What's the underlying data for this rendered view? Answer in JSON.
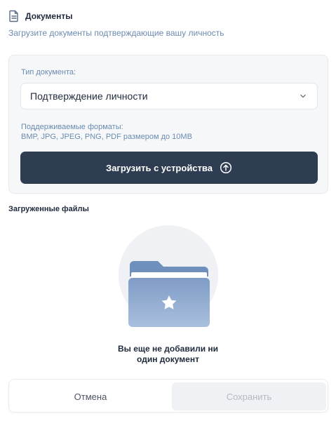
{
  "header": {
    "title": "Документы",
    "subtitle": "Загрузите документы подтверждающие вашу личность"
  },
  "form": {
    "doc_type_label": "Тип документа:",
    "doc_type_value": "Подтверждение личности",
    "formats_line1": "Поддерживаемые форматы:",
    "formats_line2": "BMP, JPG, JPEG, PNG, PDF размером до 10MB",
    "upload_label": "Загрузить с устройства"
  },
  "uploaded": {
    "title": "Загруженные файлы",
    "empty_line1": "Вы еще не добавили ни",
    "empty_line2": "один документ"
  },
  "footer": {
    "cancel_label": "Отмена",
    "save_label": "Сохранить"
  },
  "icons": {
    "document": "document-icon",
    "chevron": "chevron-down-icon",
    "upload": "upload-arrow-icon",
    "folder": "folder-star-icon"
  },
  "colors": {
    "primary_button": "#2f3d52",
    "muted_text": "#6b8bb0",
    "folder": "#8aa6cf"
  }
}
